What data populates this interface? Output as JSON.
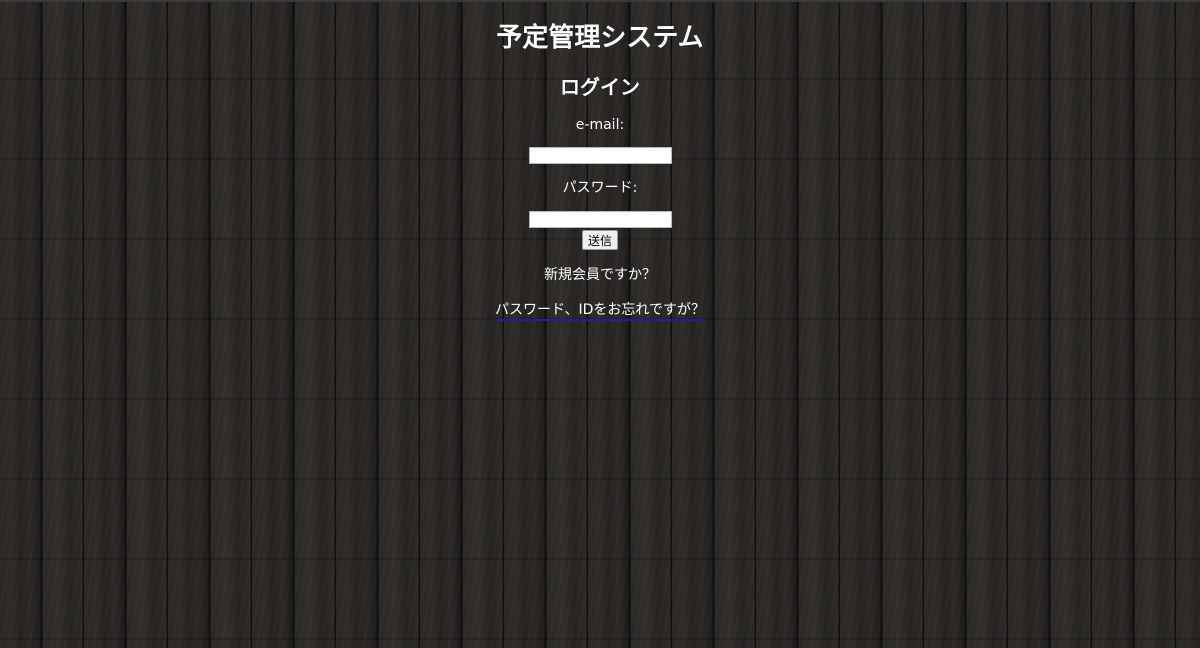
{
  "app_title": "予定管理システム",
  "login": {
    "heading": "ログイン",
    "email_label": "e-mail:",
    "email_value": "",
    "password_label": "パスワード:",
    "password_value": "",
    "submit_label": "送信"
  },
  "links": {
    "register": "新規会員ですか？",
    "forgot": "パスワード、IDをお忘れですが？"
  },
  "colors": {
    "background": "#242322",
    "text": "#ffffff",
    "link_underline": "#1d1fa6"
  }
}
